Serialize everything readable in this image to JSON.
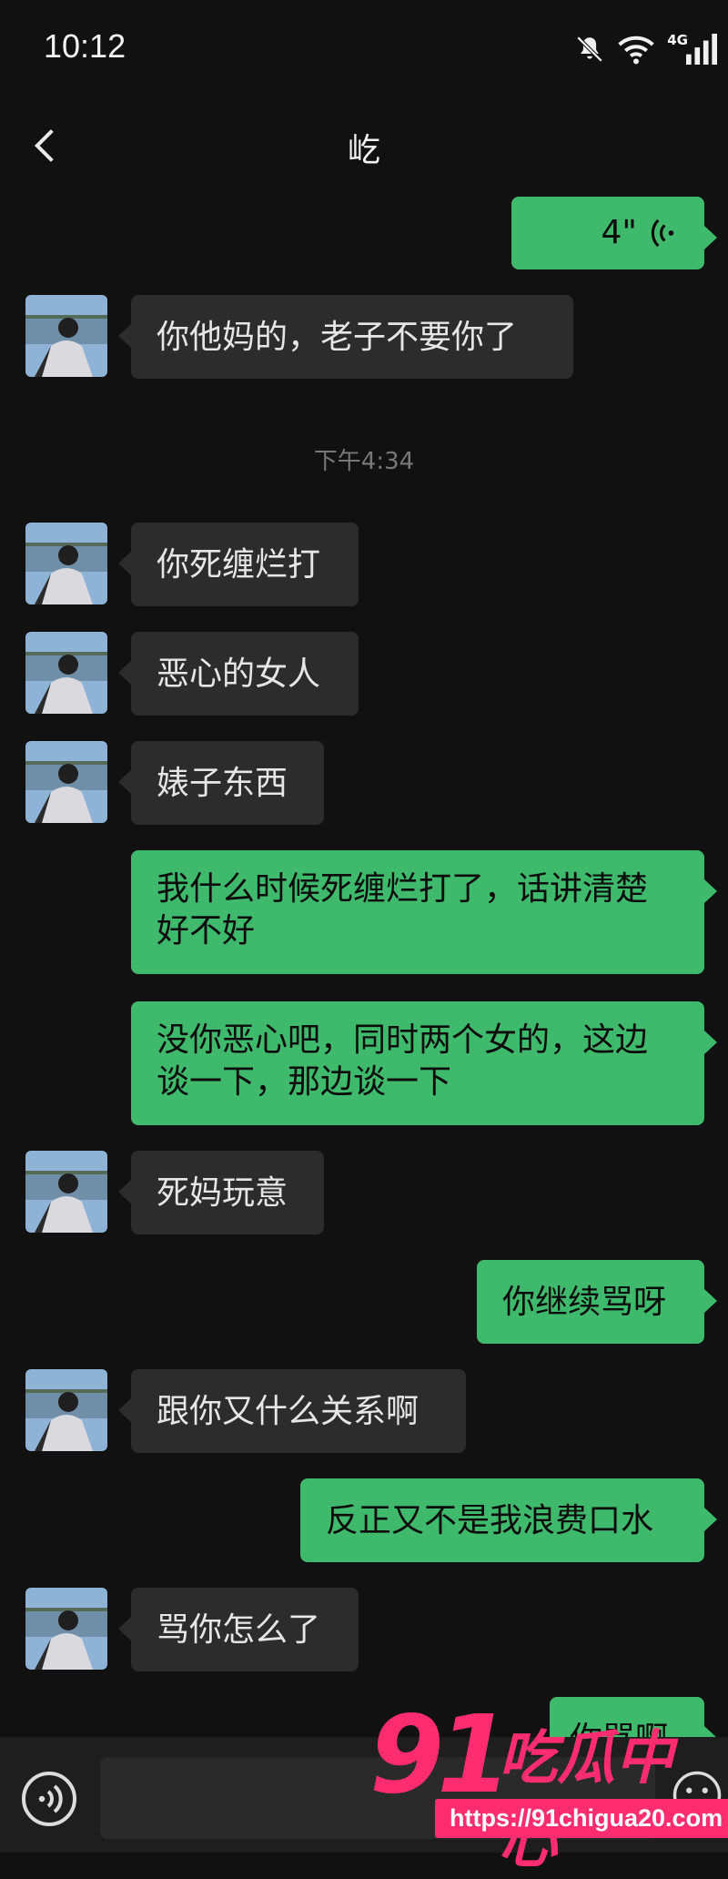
{
  "status_bar": {
    "time": "10:12",
    "network": "4G"
  },
  "nav": {
    "title": "屹"
  },
  "messages": [
    {
      "voice_duration": "4\""
    },
    {
      "text": "你他妈的，老子不要你了"
    },
    {
      "text": "你死缠烂打"
    },
    {
      "text": "恶心的女人"
    },
    {
      "text": "婊子东西"
    },
    {
      "line1": "我什么时候死缠烂打了，话讲清楚",
      "line2": "好不好"
    },
    {
      "line1": "没你恶心吧，同时两个女的，这边",
      "line2": "谈一下，那边谈一下"
    },
    {
      "text": "死妈玩意"
    },
    {
      "text": "你继续骂呀"
    },
    {
      "text": "跟你又什么关系啊"
    },
    {
      "text": "反正又不是我浪费口水"
    },
    {
      "text": "骂你怎么了"
    },
    {
      "text": "你骂啊"
    }
  ],
  "timestamp": "下午4:34",
  "watermark": {
    "number": "91",
    "brand": "吃瓜中心",
    "url": "https://91chigua20.com"
  },
  "colors": {
    "incoming_bubble": "#2c2c2c",
    "outgoing_bubble": "#3fb96b",
    "background": "#111111",
    "watermark": "#ff2d6f"
  }
}
